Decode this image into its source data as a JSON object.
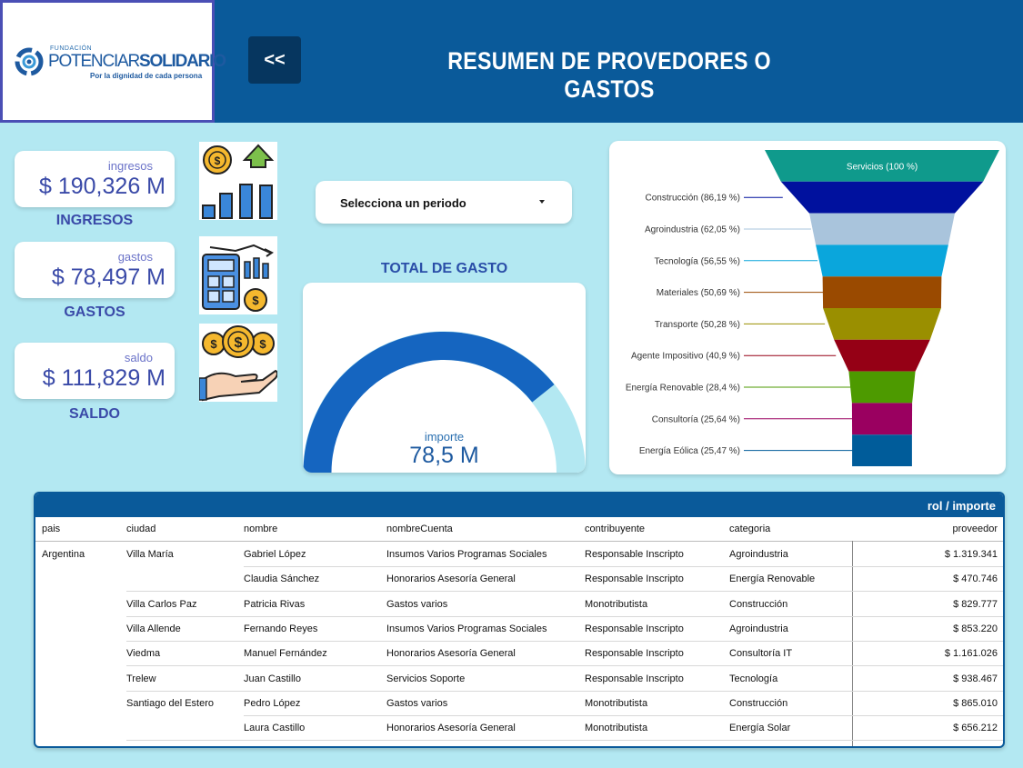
{
  "header": {
    "logo": {
      "fund": "FUNDACIÓN",
      "name_part1": "POTENCIAR",
      "name_part2": "SOLIDARIO",
      "tagline": "Por la dignidad de cada persona"
    },
    "back_label": "<<",
    "title": "RESUMEN DE PROVEDORES O GASTOS"
  },
  "kpis": [
    {
      "small": "ingresos",
      "value": "$ 190,326 M",
      "label": "INGRESOS"
    },
    {
      "small": "gastos",
      "value": "$ 78,497 M",
      "label": "GASTOS"
    },
    {
      "small": "saldo",
      "value": "$ 111,829 M",
      "label": "SALDO"
    }
  ],
  "icons": [
    "revenue-growth-icon",
    "expense-calculator-icon",
    "money-hand-icon"
  ],
  "period": {
    "label": "Selecciona un periodo"
  },
  "gauge": {
    "title": "TOTAL DE GASTO",
    "label": "importe",
    "value_text": "78,5 M",
    "fraction": 0.785,
    "colors": {
      "fill": "#1565c0",
      "track": "#b3e8f2"
    }
  },
  "chart_data": {
    "type": "funnel",
    "categories": [
      "Servicios",
      "Construcción",
      "Agroindustria",
      "Tecnología",
      "Materiales",
      "Transporte",
      "Agente Impositivo",
      "Energía Renovable",
      "Consultoría",
      "Energía Eólica"
    ],
    "values": [
      100,
      86.19,
      62.05,
      56.55,
      50.69,
      50.28,
      40.9,
      28.4,
      25.64,
      25.47
    ],
    "labels": [
      "Servicios (100 %)",
      "Construcción (86,19 %)",
      "Agroindustria (62,05 %)",
      "Tecnología (56,55 %)",
      "Materiales (50,69 %)",
      "Transporte (50,28 %)",
      "Agente Impositivo (40,9 %)",
      "Energía Renovable (28,4 %)",
      "Consultoría (25,64 %)",
      "Energía Eólica (25,47 %)"
    ],
    "colors": [
      "#0f9a8c",
      "#00119e",
      "#a9c4dc",
      "#0aa6dc",
      "#9a4a00",
      "#9a8f00",
      "#950015",
      "#4d9a00",
      "#9a0060",
      "#005c9a"
    ]
  },
  "table": {
    "bar_label": "rol / importe",
    "headers": [
      "pais",
      "ciudad",
      "nombre",
      "nombreCuenta",
      "contribuyente",
      "categoria",
      "proveedor"
    ],
    "rows": [
      {
        "pais": "Argentina",
        "ciudad": "Villa María",
        "nombre": "Gabriel López",
        "cuenta": "Insumos Varios Programas Sociales",
        "contrib": "Responsable Inscripto",
        "categoria": "Agroindustria",
        "importe": "$ 1.319.341"
      },
      {
        "pais": "",
        "ciudad": "",
        "nombre": "Claudia Sánchez",
        "cuenta": "Honorarios Asesoría General",
        "contrib": "Responsable Inscripto",
        "categoria": "Energía Renovable",
        "importe": "$ 470.746"
      },
      {
        "pais": "",
        "ciudad": "Villa Carlos Paz",
        "nombre": "Patricia Rivas",
        "cuenta": "Gastos varios",
        "contrib": "Monotributista",
        "categoria": "Construcción",
        "importe": "$ 829.777"
      },
      {
        "pais": "",
        "ciudad": "Villa Allende",
        "nombre": "Fernando Reyes",
        "cuenta": "Insumos Varios Programas Sociales",
        "contrib": "Responsable Inscripto",
        "categoria": "Agroindustria",
        "importe": "$ 853.220"
      },
      {
        "pais": "",
        "ciudad": "Viedma",
        "nombre": "Manuel Fernández",
        "cuenta": "Honorarios Asesoría General",
        "contrib": "Responsable Inscripto",
        "categoria": "Consultoría IT",
        "importe": "$ 1.161.026"
      },
      {
        "pais": "",
        "ciudad": "Trelew",
        "nombre": "Juan Castillo",
        "cuenta": "Servicios Soporte",
        "contrib": "Responsable Inscripto",
        "categoria": "Tecnología",
        "importe": "$ 938.467"
      },
      {
        "pais": "",
        "ciudad": "Santiago del Estero",
        "nombre": "Pedro López",
        "cuenta": "Gastos varios",
        "contrib": "Monotributista",
        "categoria": "Construcción",
        "importe": "$ 865.010"
      },
      {
        "pais": "",
        "ciudad": "",
        "nombre": "Laura Castillo",
        "cuenta": "Honorarios Asesoría General",
        "contrib": "Monotributista",
        "categoria": "Energía Solar",
        "importe": "$ 656.212"
      }
    ]
  }
}
